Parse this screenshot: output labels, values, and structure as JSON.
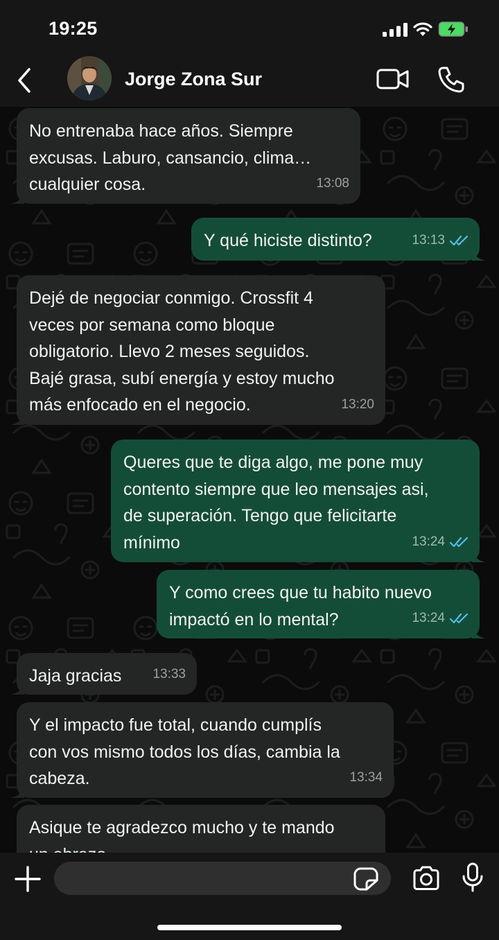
{
  "status_bar": {
    "time": "19:25"
  },
  "header": {
    "contact_name": "Jorge Zona Sur"
  },
  "icons": {
    "back": "chevron-left-icon",
    "video": "video-camera-icon",
    "call": "phone-icon",
    "plus": "plus-icon",
    "sticker": "sticker-icon",
    "camera": "camera-icon",
    "mic": "microphone-icon",
    "read": "double-check-icon"
  },
  "colors": {
    "incoming_bubble": "#242626",
    "outgoing_bubble": "#144d37",
    "read_ticks": "#53bdeb",
    "background": "#0b0b0b",
    "bars": "#161616"
  },
  "messages": [
    {
      "direction": "in",
      "text": "No entrenaba hace años. Siempre\nexcusas. Laburo, cansancio, clima…\ncualquier cosa.",
      "time": "13:08"
    },
    {
      "direction": "out",
      "text": "Y qué hiciste distinto?",
      "time": "13:13",
      "status": "read"
    },
    {
      "direction": "in",
      "text": "Dejé de negociar conmigo. Crossfit 4\nveces por semana como bloque\nobligatorio. Llevo 2 meses seguidos.\nBajé grasa, subí energía y estoy mucho\nmás enfocado en el negocio.",
      "time": "13:20"
    },
    {
      "direction": "out",
      "text": "Queres que te diga algo, me pone muy\ncontento siempre que leo mensajes asi,\nde superación. Tengo que felicitarte\nmínimo",
      "time": "13:24",
      "status": "read"
    },
    {
      "direction": "out",
      "text": "Y como crees que tu habito nuevo\nimpactó en lo mental?",
      "time": "13:24",
      "status": "read"
    },
    {
      "direction": "in",
      "text": "Jaja gracias",
      "time": "13:33"
    },
    {
      "direction": "in",
      "text": "Y el impacto fue total, cuando cumplís\ncon vos mismo todos los días, cambia la\ncabeza.",
      "time": "13:34"
    },
    {
      "direction": "in",
      "text": "Asique te agradezco mucho y te mando\nun abrazo",
      "time": ""
    }
  ],
  "composer": {
    "value": ""
  }
}
